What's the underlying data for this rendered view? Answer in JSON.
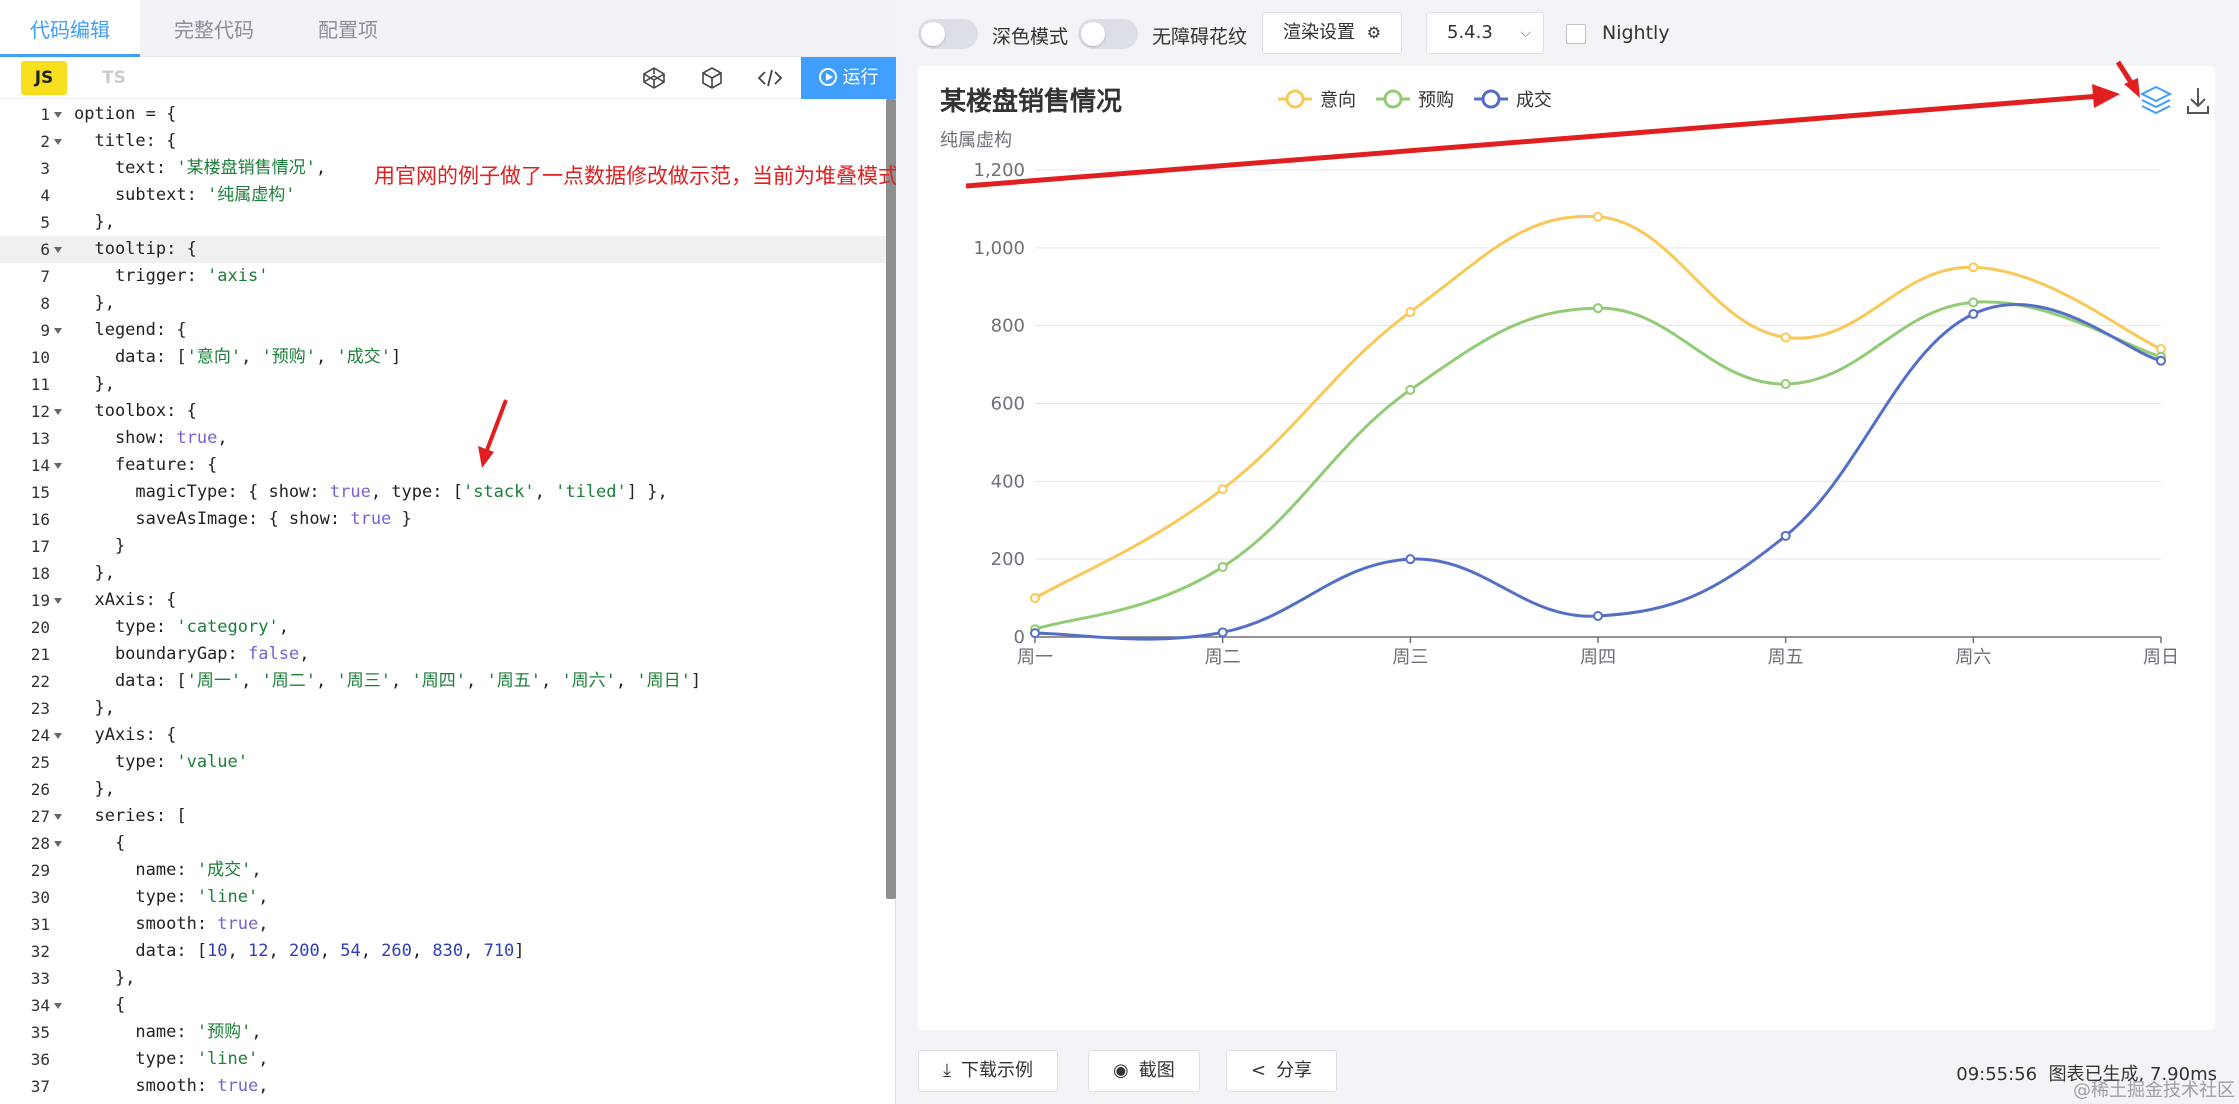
{
  "editor_tabs": [
    "代码编辑",
    "完整代码",
    "配置项"
  ],
  "toolbar": {
    "js_label": "JS",
    "ts_label": "TS",
    "run_label": "运行"
  },
  "annotation": "用官网的例子做了一点数据修改做示范，当前为堆叠模式",
  "code_lines": [
    {
      "n": 1,
      "fold": true,
      "html": "option = {"
    },
    {
      "n": 2,
      "fold": true,
      "html": "  title: {"
    },
    {
      "n": 3,
      "fold": false,
      "html": "    text: <span class='s'>'某楼盘销售情况'</span>,"
    },
    {
      "n": 4,
      "fold": false,
      "html": "    subtext: <span class='s'>'纯属虚构'</span>"
    },
    {
      "n": 5,
      "fold": false,
      "html": "  },"
    },
    {
      "n": 6,
      "fold": true,
      "html": "  tooltip: {",
      "hl": true
    },
    {
      "n": 7,
      "fold": false,
      "html": "    trigger: <span class='s'>'axis'</span>"
    },
    {
      "n": 8,
      "fold": false,
      "html": "  },"
    },
    {
      "n": 9,
      "fold": true,
      "html": "  legend: {"
    },
    {
      "n": 10,
      "fold": false,
      "html": "    data: [<span class='s'>'意向'</span>, <span class='s'>'预购'</span>, <span class='s'>'成交'</span>]"
    },
    {
      "n": 11,
      "fold": false,
      "html": "  },"
    },
    {
      "n": 12,
      "fold": true,
      "html": "  toolbox: {"
    },
    {
      "n": 13,
      "fold": false,
      "html": "    show: <span class='k'>true</span>,"
    },
    {
      "n": 14,
      "fold": true,
      "html": "    feature: {"
    },
    {
      "n": 15,
      "fold": false,
      "html": "      magicType: { show: <span class='k'>true</span>, type: [<span class='s'>'stack'</span>, <span class='s'>'tiled'</span>] },"
    },
    {
      "n": 16,
      "fold": false,
      "html": "      saveAsImage: { show: <span class='k'>true</span> }"
    },
    {
      "n": 17,
      "fold": false,
      "html": "    }"
    },
    {
      "n": 18,
      "fold": false,
      "html": "  },"
    },
    {
      "n": 19,
      "fold": true,
      "html": "  xAxis: {"
    },
    {
      "n": 20,
      "fold": false,
      "html": "    type: <span class='s'>'category'</span>,"
    },
    {
      "n": 21,
      "fold": false,
      "html": "    boundaryGap: <span class='k'>false</span>,"
    },
    {
      "n": 22,
      "fold": false,
      "html": "    data: [<span class='s'>'周一'</span>, <span class='s'>'周二'</span>, <span class='s'>'周三'</span>, <span class='s'>'周四'</span>, <span class='s'>'周五'</span>, <span class='s'>'周六'</span>, <span class='s'>'周日'</span>]"
    },
    {
      "n": 23,
      "fold": false,
      "html": "  },"
    },
    {
      "n": 24,
      "fold": true,
      "html": "  yAxis: {"
    },
    {
      "n": 25,
      "fold": false,
      "html": "    type: <span class='s'>'value'</span>"
    },
    {
      "n": 26,
      "fold": false,
      "html": "  },"
    },
    {
      "n": 27,
      "fold": true,
      "html": "  series: ["
    },
    {
      "n": 28,
      "fold": true,
      "html": "    {"
    },
    {
      "n": 29,
      "fold": false,
      "html": "      name: <span class='s'>'成交'</span>,"
    },
    {
      "n": 30,
      "fold": false,
      "html": "      type: <span class='s'>'line'</span>,"
    },
    {
      "n": 31,
      "fold": false,
      "html": "      smooth: <span class='k'>true</span>,"
    },
    {
      "n": 32,
      "fold": false,
      "html": "      data: [<span class='n'>10</span>, <span class='n'>12</span>, <span class='n'>200</span>, <span class='n'>54</span>, <span class='n'>260</span>, <span class='n'>830</span>, <span class='n'>710</span>]"
    },
    {
      "n": 33,
      "fold": false,
      "html": "    },"
    },
    {
      "n": 34,
      "fold": true,
      "html": "    {"
    },
    {
      "n": 35,
      "fold": false,
      "html": "      name: <span class='s'>'预购'</span>,"
    },
    {
      "n": 36,
      "fold": false,
      "html": "      type: <span class='s'>'line'</span>,"
    },
    {
      "n": 37,
      "fold": false,
      "html": "      smooth: <span class='k'>true</span>,"
    }
  ],
  "topbar": {
    "dark_mode_label": "深色模式",
    "a11y_label": "无障碍花纹",
    "render_settings_label": "渲染设置",
    "version": "5.4.3",
    "nightly_label": "Nightly"
  },
  "bottom": {
    "download_label": "下载示例",
    "screenshot_label": "截图",
    "share_label": "分享",
    "time": "09:55:56",
    "status_text": "图表已生成, 7.90ms",
    "watermark": "@稀土掘金技术社区"
  },
  "colors": {
    "accent": "#409eff",
    "yixiang": "#fac858",
    "yugou": "#91cc75",
    "chengjiao": "#5470c6",
    "annotation": "#e02020"
  },
  "chart_data": {
    "type": "line",
    "title": "某楼盘销售情况",
    "subtitle": "纯属虚构",
    "categories": [
      "周一",
      "周二",
      "周三",
      "周四",
      "周五",
      "周六",
      "周日"
    ],
    "ylim": [
      0,
      1200
    ],
    "yticks": [
      0,
      200,
      400,
      600,
      800,
      1000,
      1200
    ],
    "ytick_labels": [
      "0",
      "200",
      "400",
      "600",
      "800",
      "1,000",
      "1,200"
    ],
    "smooth": true,
    "stacked": true,
    "legend_position": "top-center",
    "grid": true,
    "series": [
      {
        "name": "意向",
        "values": [
          100,
          380,
          835,
          1080,
          770,
          950,
          740
        ],
        "color": "#fac858"
      },
      {
        "name": "预购",
        "values": [
          20,
          180,
          635,
          845,
          650,
          860,
          720
        ],
        "color": "#91cc75"
      },
      {
        "name": "成交",
        "values": [
          10,
          12,
          200,
          54,
          260,
          830,
          710
        ],
        "color": "#5470c6"
      }
    ]
  }
}
